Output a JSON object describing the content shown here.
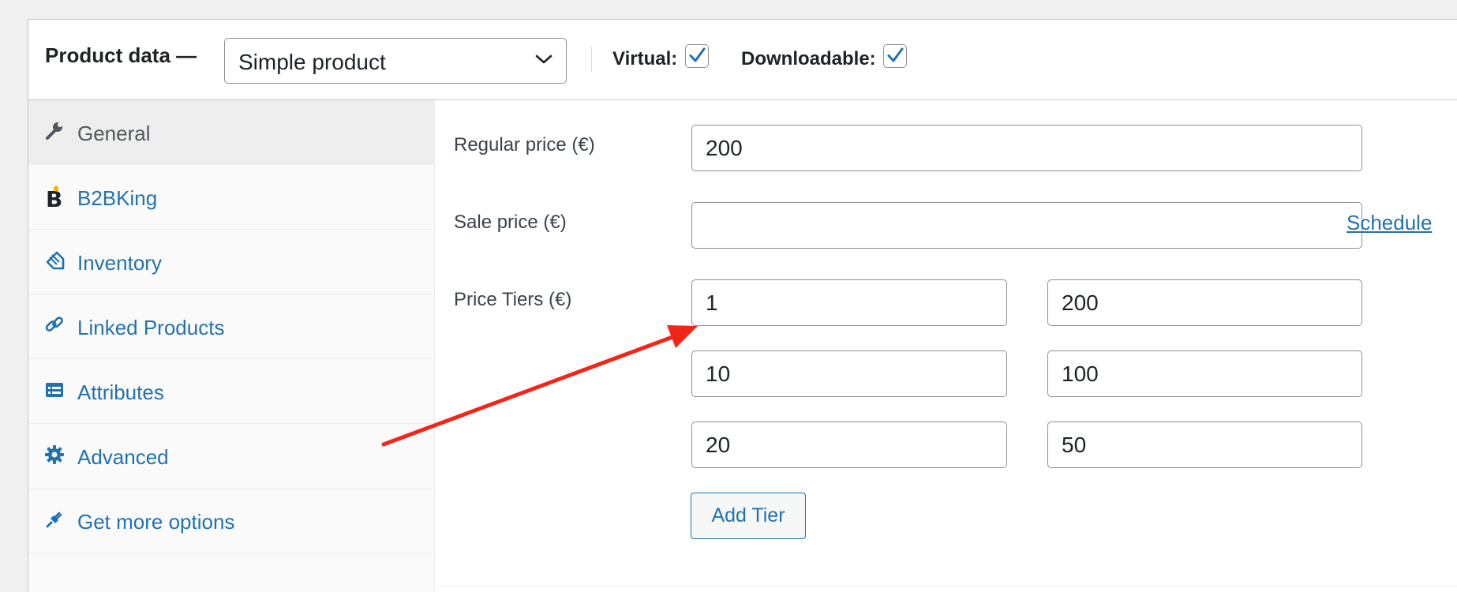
{
  "header": {
    "title": "Product data —",
    "product_type": "Simple product",
    "virtual_label": "Virtual:",
    "virtual_checked": true,
    "downloadable_label": "Downloadable:",
    "downloadable_checked": true
  },
  "sidebar": {
    "items": [
      {
        "label": "General",
        "icon": "wrench-icon",
        "active": true
      },
      {
        "label": "B2BKing",
        "icon": "b2bking-logo-icon",
        "active": false
      },
      {
        "label": "Inventory",
        "icon": "tag-icon",
        "active": false
      },
      {
        "label": "Linked Products",
        "icon": "link-icon",
        "active": false
      },
      {
        "label": "Attributes",
        "icon": "list-table-icon",
        "active": false
      },
      {
        "label": "Advanced",
        "icon": "gear-icon",
        "active": false
      },
      {
        "label": "Get more options",
        "icon": "plugin-icon",
        "active": false
      }
    ]
  },
  "general": {
    "regular_price_label": "Regular price (€)",
    "regular_price_value": "200",
    "sale_price_label": "Sale price (€)",
    "sale_price_value": "",
    "schedule_link": "Schedule",
    "price_tiers_label": "Price Tiers (€)",
    "tiers": [
      {
        "quantity": "1",
        "price": "200"
      },
      {
        "quantity": "10",
        "price": "100"
      },
      {
        "quantity": "20",
        "price": "50"
      }
    ],
    "add_tier_label": "Add Tier"
  },
  "colors": {
    "accent": "#2271b1",
    "arrow": "#f0261b"
  }
}
